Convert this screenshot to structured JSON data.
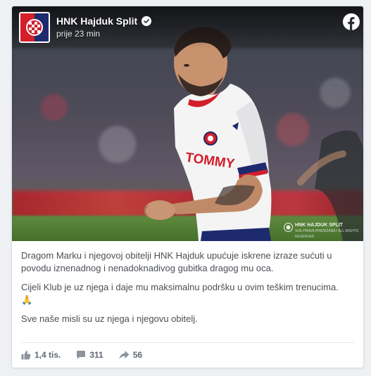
{
  "post": {
    "page_name": "HNK Hajduk Split",
    "timestamp": "prije 23 min",
    "paragraphs": [
      "Dragom Marku i njegovoj obitelji HNK Hajduk upućuje iskrene izraze sućuti u povodu iznenadnog i nenadoknadivog gubitka dragog mu oca.",
      "Cijeli Klub je uz njega i daje mu maksimalnu podršku u ovim teškim trenucima. 🙏",
      "Sve naše misli su uz njega i njegovu obitelj."
    ],
    "jersey_text": "TOMMY",
    "watermark": {
      "title": "HNK HAJDUK SPLIT",
      "sub": "SVE PRAVA PRIDRŽANA / ALL RIGHTS RESERVED"
    }
  },
  "stats": {
    "likes": "1,4 tis.",
    "comments": "311",
    "shares": "56"
  },
  "icons": [
    "club-crest-icon",
    "verified-icon",
    "facebook-icon",
    "like-icon",
    "comment-icon",
    "share-icon"
  ],
  "colors": {
    "brand_blue": "#1877f2",
    "hajduk_red": "#d21f2b",
    "hajduk_navy": "#1e2a6e",
    "text": "#4b4f56"
  }
}
